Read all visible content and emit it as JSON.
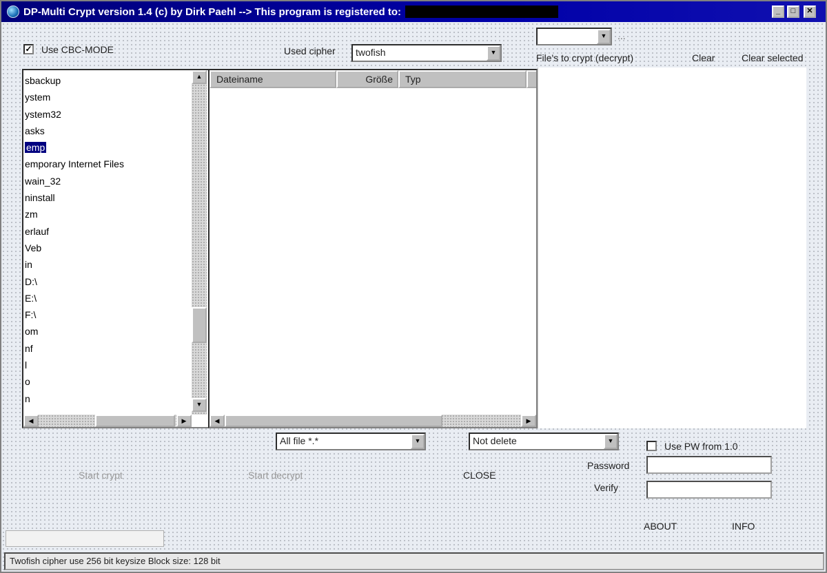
{
  "window": {
    "title": "DP-Multi Crypt version 1.4 (c) by Dirk Paehl --> This program is registered to:",
    "controls": {
      "minimize": "_",
      "maximize": "□",
      "close": "✕"
    }
  },
  "options": {
    "cbc_label": "Use CBC-MODE",
    "cbc_checked": "✓",
    "cipher_label": "Used cipher",
    "cipher_value": "twofish",
    "drive_value": "",
    "drive_ellipsis": "..."
  },
  "crypt_panel": {
    "header": "File's to crypt (decrypt)",
    "clear": "Clear",
    "clear_selected": "Clear selected"
  },
  "directories": [
    "sbackup",
    "ystem",
    "ystem32",
    "asks",
    "emp",
    "emporary Internet Files",
    "wain_32",
    "ninstall",
    "zm",
    "erlauf",
    "Veb",
    "in",
    "D:\\",
    "E:\\",
    "F:\\",
    "om",
    "nf",
    "l",
    "o",
    "n"
  ],
  "selected_directory_index": 4,
  "file_columns": {
    "name": "Dateiname",
    "size": "Größe",
    "type": "Typ"
  },
  "filters": {
    "file_mask": "All file *.*",
    "delete_mode": "Not delete"
  },
  "pw_option": {
    "label": "Use PW from 1.0",
    "checked": ""
  },
  "password": {
    "label": "Password",
    "verify_label": "Verify"
  },
  "buttons": {
    "start_crypt": "Start crypt",
    "start_decrypt": "Start decrypt",
    "close": "CLOSE",
    "about": "ABOUT",
    "info": "INFO"
  },
  "status": "Twofish cipher use 256 bit keysize Block size: 128 bit"
}
